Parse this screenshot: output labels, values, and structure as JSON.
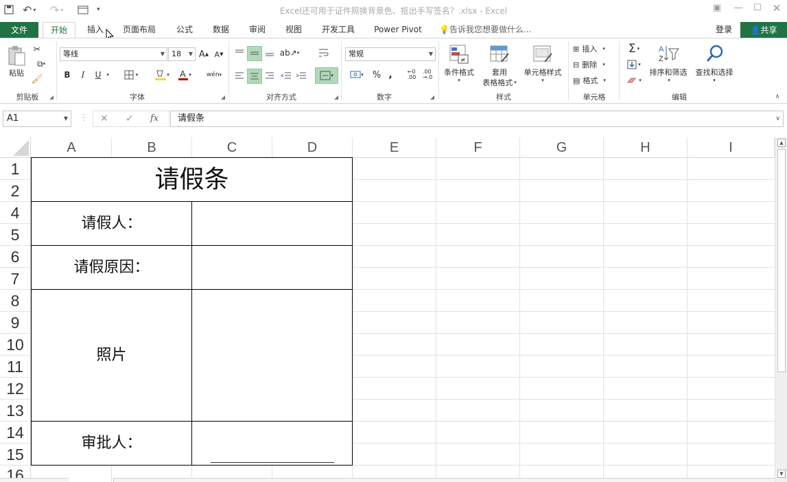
{
  "titlebar": {
    "title": "Excel还可用于证件照换背景色、抠出手写签名？.xlsx - Excel"
  },
  "tabs": {
    "file": "文件",
    "items": [
      "开始",
      "插入",
      "页面布局",
      "公式",
      "数据",
      "审阅",
      "视图",
      "开发工具",
      "Power Pivot"
    ],
    "tell_me": "告诉我您想要做什么...",
    "login": "登录",
    "share": "共享"
  },
  "ribbon": {
    "clipboard": {
      "paste": "粘贴",
      "label": "剪贴板"
    },
    "font": {
      "name": "等线",
      "size": "18",
      "label": "字体",
      "bold": "B",
      "italic": "I",
      "underline": "U"
    },
    "alignment": {
      "label": "对齐方式"
    },
    "number": {
      "format": "常规",
      "label": "数字",
      "percent": "%",
      "comma": ","
    },
    "styles": {
      "conditional": "条件格式",
      "table1": "套用",
      "table2": "表格格式",
      "cell_styles": "单元格样式",
      "label": "样式"
    },
    "cells": {
      "insert": "插入",
      "delete": "删除",
      "format": "格式",
      "label": "单元格"
    },
    "editing": {
      "sort": "排序和筛选",
      "find": "查找和选择",
      "label": "编辑"
    }
  },
  "formula_bar": {
    "name_box": "A1",
    "content": "请假条",
    "fx": "fx"
  },
  "columns": [
    "A",
    "B",
    "C",
    "D",
    "E",
    "F",
    "G",
    "H",
    "I"
  ],
  "rows": [
    "1",
    "2",
    "4",
    "5",
    "6",
    "7",
    "8",
    "9",
    "10",
    "11",
    "12",
    "13",
    "14",
    "15",
    "16"
  ],
  "sheet": {
    "title": "请假条",
    "applicant_label": "请假人：",
    "reason_label": "请假原因：",
    "photo_label": "照片",
    "approver_label": "审批人："
  }
}
